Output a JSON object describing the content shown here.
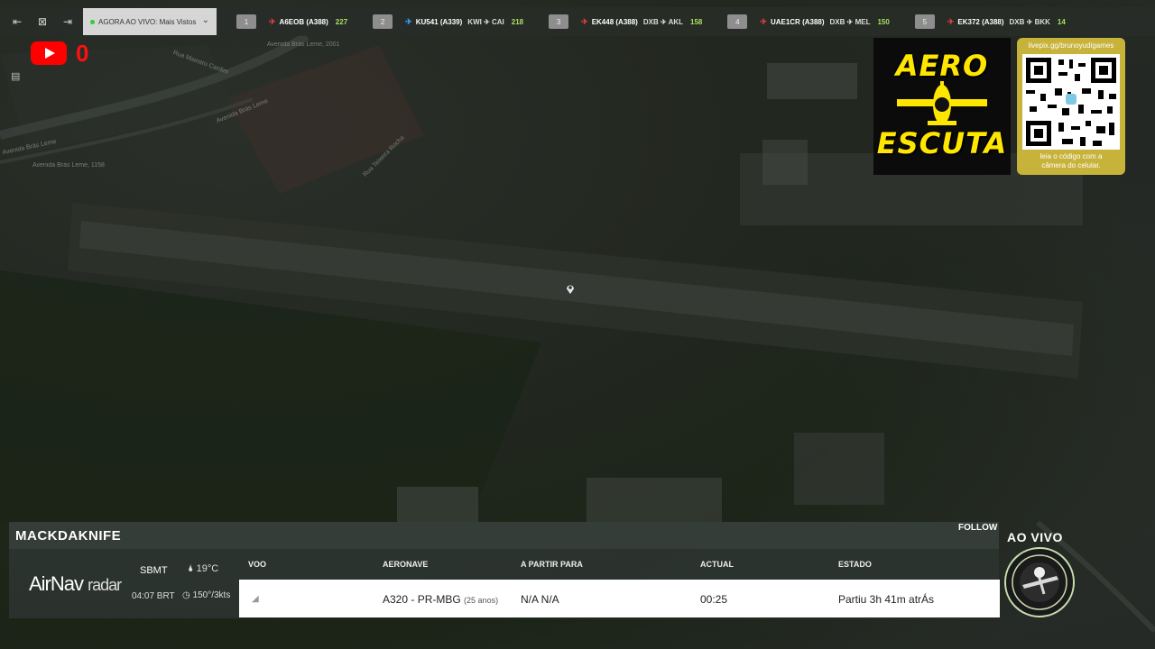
{
  "topbar": {
    "selector_label": "AGORA AO VIVO: Mais Vistos",
    "flights": [
      {
        "num": "1",
        "code": "A6EOB",
        "type": "(A388)",
        "route": "",
        "count": "227",
        "color": "red"
      },
      {
        "num": "2",
        "code": "KU541",
        "type": "(A339)",
        "route": "KWI ✈ CAI",
        "count": "218",
        "color": "blue"
      },
      {
        "num": "3",
        "code": "EK448",
        "type": "(A388)",
        "route": "DXB ✈ AKL",
        "count": "158",
        "color": "red"
      },
      {
        "num": "4",
        "code": "UAE1CR",
        "type": "(A388)",
        "route": "DXB ✈ MEL",
        "count": "150",
        "color": "red"
      },
      {
        "num": "5",
        "code": "EK372",
        "type": "(A388)",
        "route": "DXB ✈ BKK",
        "count": "14",
        "color": "red"
      }
    ]
  },
  "youtube": {
    "count": "0"
  },
  "map_labels": {
    "l1": "Avenida Brás Leme, 2001",
    "l2": "Avenida Brás Leme",
    "l3": "Avenida Brás Leme, 1158",
    "l4": "Rua Maestro Cardim",
    "l5": "Avenida Brás Leme",
    "l6": "Rua Teixeira Rocha"
  },
  "logo": {
    "line1": "AERO",
    "line2": "ESCUTA"
  },
  "qr": {
    "url": "livepix.gg/brunoyudigames",
    "caption_1": "leia o código com a",
    "caption_2": "câmera do celular."
  },
  "panel": {
    "callsign": "MACKDAKNIFE",
    "follow": "FOLLOW",
    "brand_1": "AirNav",
    "brand_2": "radar",
    "airport": "SBMT",
    "local_time": "04:07 BRT",
    "temperature": "19°C",
    "wind": "150°/3kts",
    "headers": {
      "voo": "VOO",
      "aeronave": "AERONAVE",
      "rota": "A PARTIR PARA",
      "actual": "ACTUAL",
      "estado": "ESTADO"
    },
    "row": {
      "aircraft": "A320 - PR-MBG",
      "age": "(25 anos)",
      "route": "N/A N/A",
      "actual": "00:25",
      "status": "Partiu 3h 41m atrÁs"
    }
  },
  "live": {
    "label": "AO VIVO"
  }
}
